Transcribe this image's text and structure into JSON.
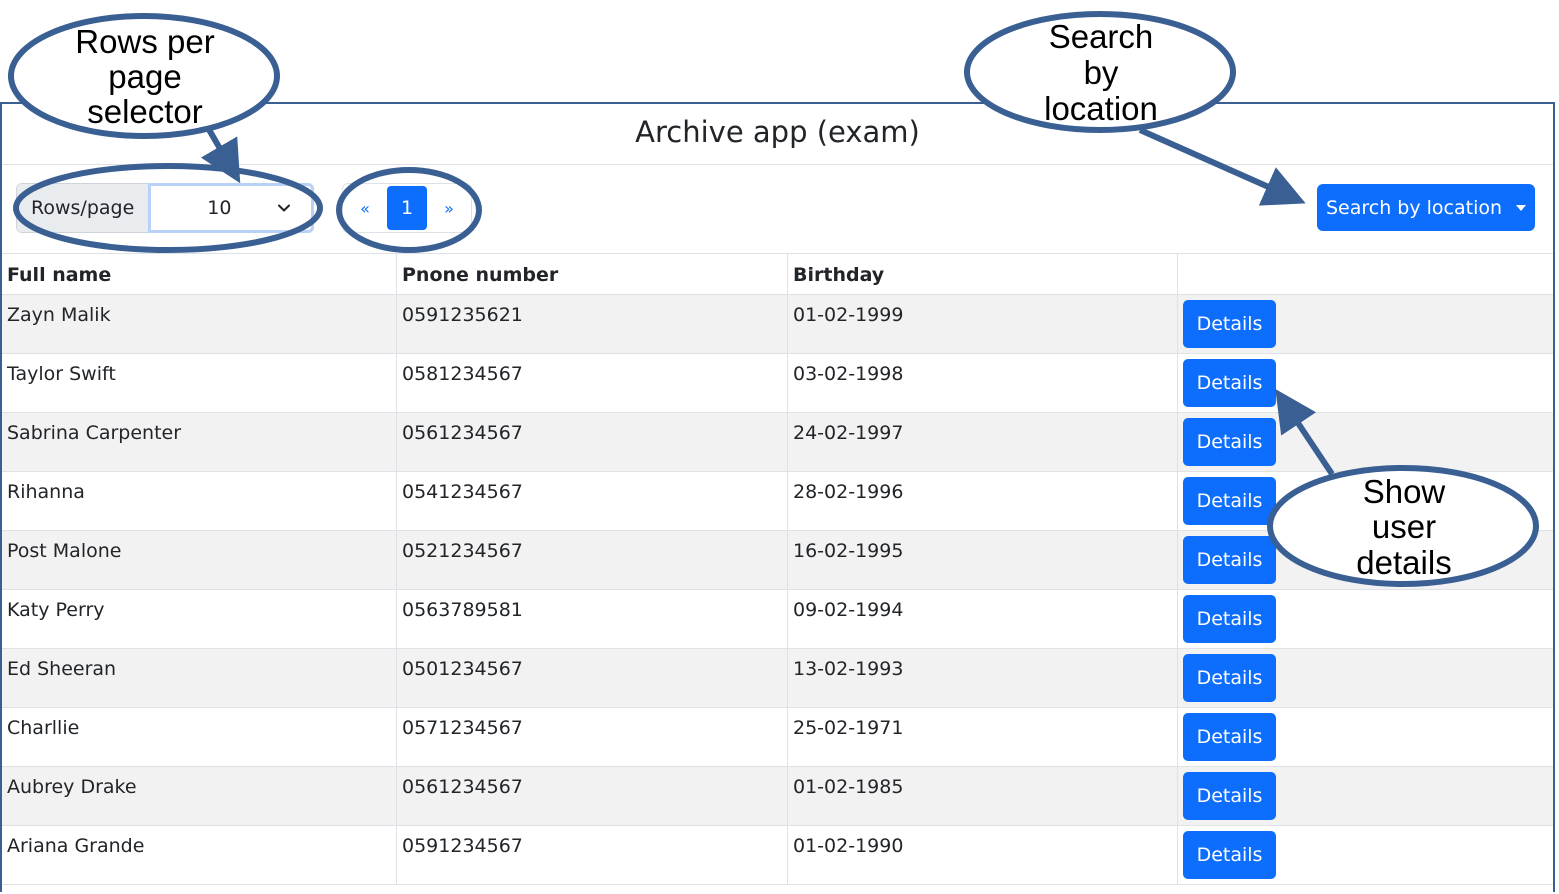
{
  "app": {
    "title": "Archive app (exam)"
  },
  "toolbar": {
    "rows_label": "Rows/page",
    "rows_value": "10",
    "pager": {
      "prev": "«",
      "current": "1",
      "next": "»"
    },
    "search_label": "Search by location"
  },
  "table": {
    "headers": [
      "Full name",
      "Pnone number",
      "Birthday",
      ""
    ],
    "rows": [
      {
        "name": "Zayn Malik",
        "phone": "0591235621",
        "birthday": "01-02-1999",
        "action": "Details"
      },
      {
        "name": "Taylor Swift",
        "phone": "0581234567",
        "birthday": "03-02-1998",
        "action": "Details"
      },
      {
        "name": "Sabrina Carpenter",
        "phone": "0561234567",
        "birthday": "24-02-1997",
        "action": "Details"
      },
      {
        "name": "Rihanna",
        "phone": "0541234567",
        "birthday": "28-02-1996",
        "action": "Details"
      },
      {
        "name": "Post Malone",
        "phone": "0521234567",
        "birthday": "16-02-1995",
        "action": "Details"
      },
      {
        "name": "Katy Perry",
        "phone": "0563789581",
        "birthday": "09-02-1994",
        "action": "Details"
      },
      {
        "name": "Ed Sheeran",
        "phone": "0501234567",
        "birthday": "13-02-1993",
        "action": "Details"
      },
      {
        "name": "Charllie",
        "phone": "0571234567",
        "birthday": "25-02-1971",
        "action": "Details"
      },
      {
        "name": "Aubrey Drake",
        "phone": "0561234567",
        "birthday": "01-02-1985",
        "action": "Details"
      },
      {
        "name": "Ariana Grande",
        "phone": "0591234567",
        "birthday": "01-02-1990",
        "action": "Details"
      }
    ]
  },
  "annotations": {
    "rows_per_page": [
      "Rows per",
      "page",
      "selector"
    ],
    "search_by_location": [
      "Search",
      "by",
      "location"
    ],
    "show_user_details": [
      "Show",
      "user",
      "details"
    ]
  },
  "colors": {
    "primary": "#0d6efd",
    "annotation": "#3a5f93",
    "stripe": "#f2f2f2"
  }
}
